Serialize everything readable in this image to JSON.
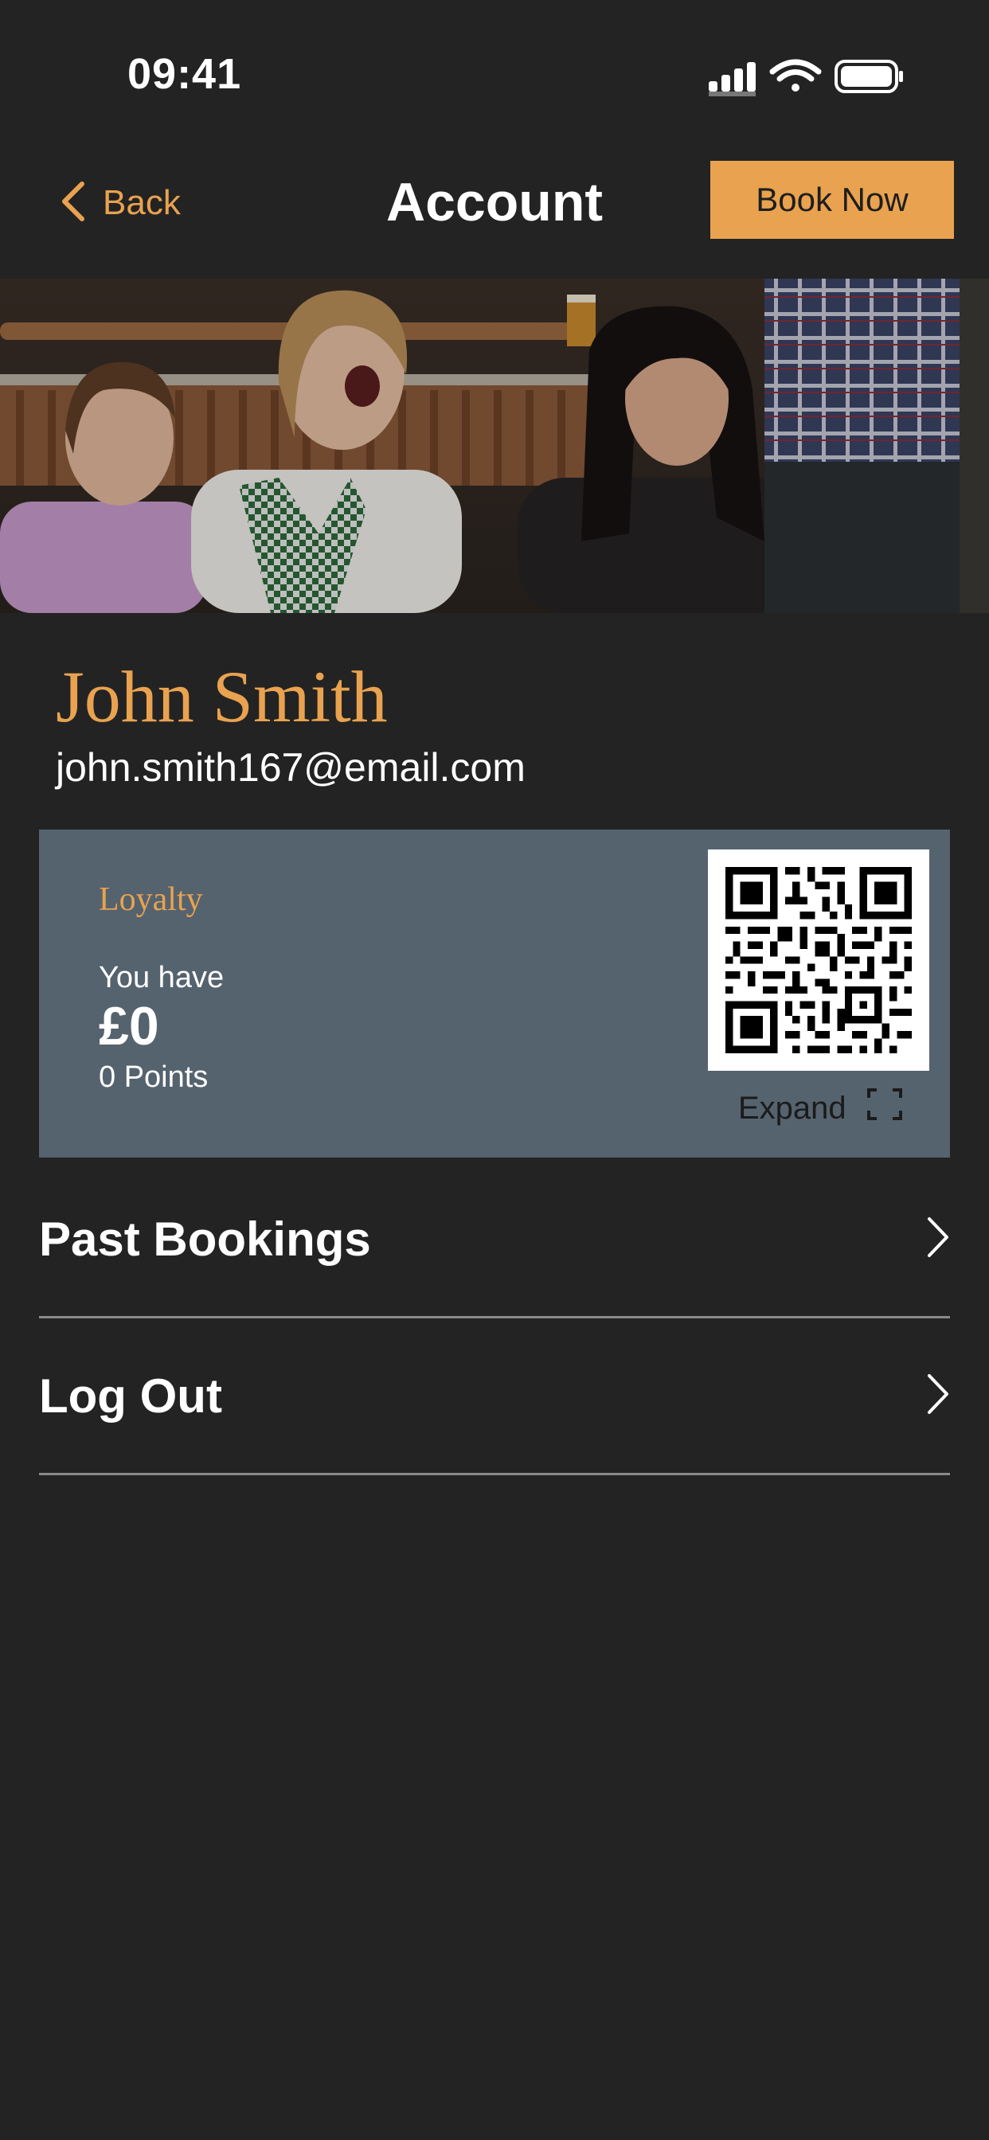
{
  "status_bar": {
    "time": "09:41"
  },
  "nav": {
    "back_label": "Back",
    "title": "Account",
    "book_label": "Book Now"
  },
  "hero": {
    "image": "photo of smiling guests seated at a bar"
  },
  "profile": {
    "name": "John Smith",
    "email": "john.smith167@email.com"
  },
  "loyalty": {
    "title": "Loyalty",
    "you_have": "You have",
    "amount": "£0",
    "points": "0 Points",
    "expand_label": "Expand"
  },
  "menu": {
    "items": [
      {
        "label": "Past Bookings"
      },
      {
        "label": "Log Out"
      }
    ]
  },
  "colors": {
    "accent": "#E9A24F",
    "background": "#232323",
    "card": "#55636f",
    "divider": "#8a8a8a"
  },
  "icons": [
    "signal-icon",
    "wifi-icon",
    "battery-icon",
    "chevron-left-icon",
    "qr-code",
    "expand-icon",
    "chevron-right-icon"
  ]
}
